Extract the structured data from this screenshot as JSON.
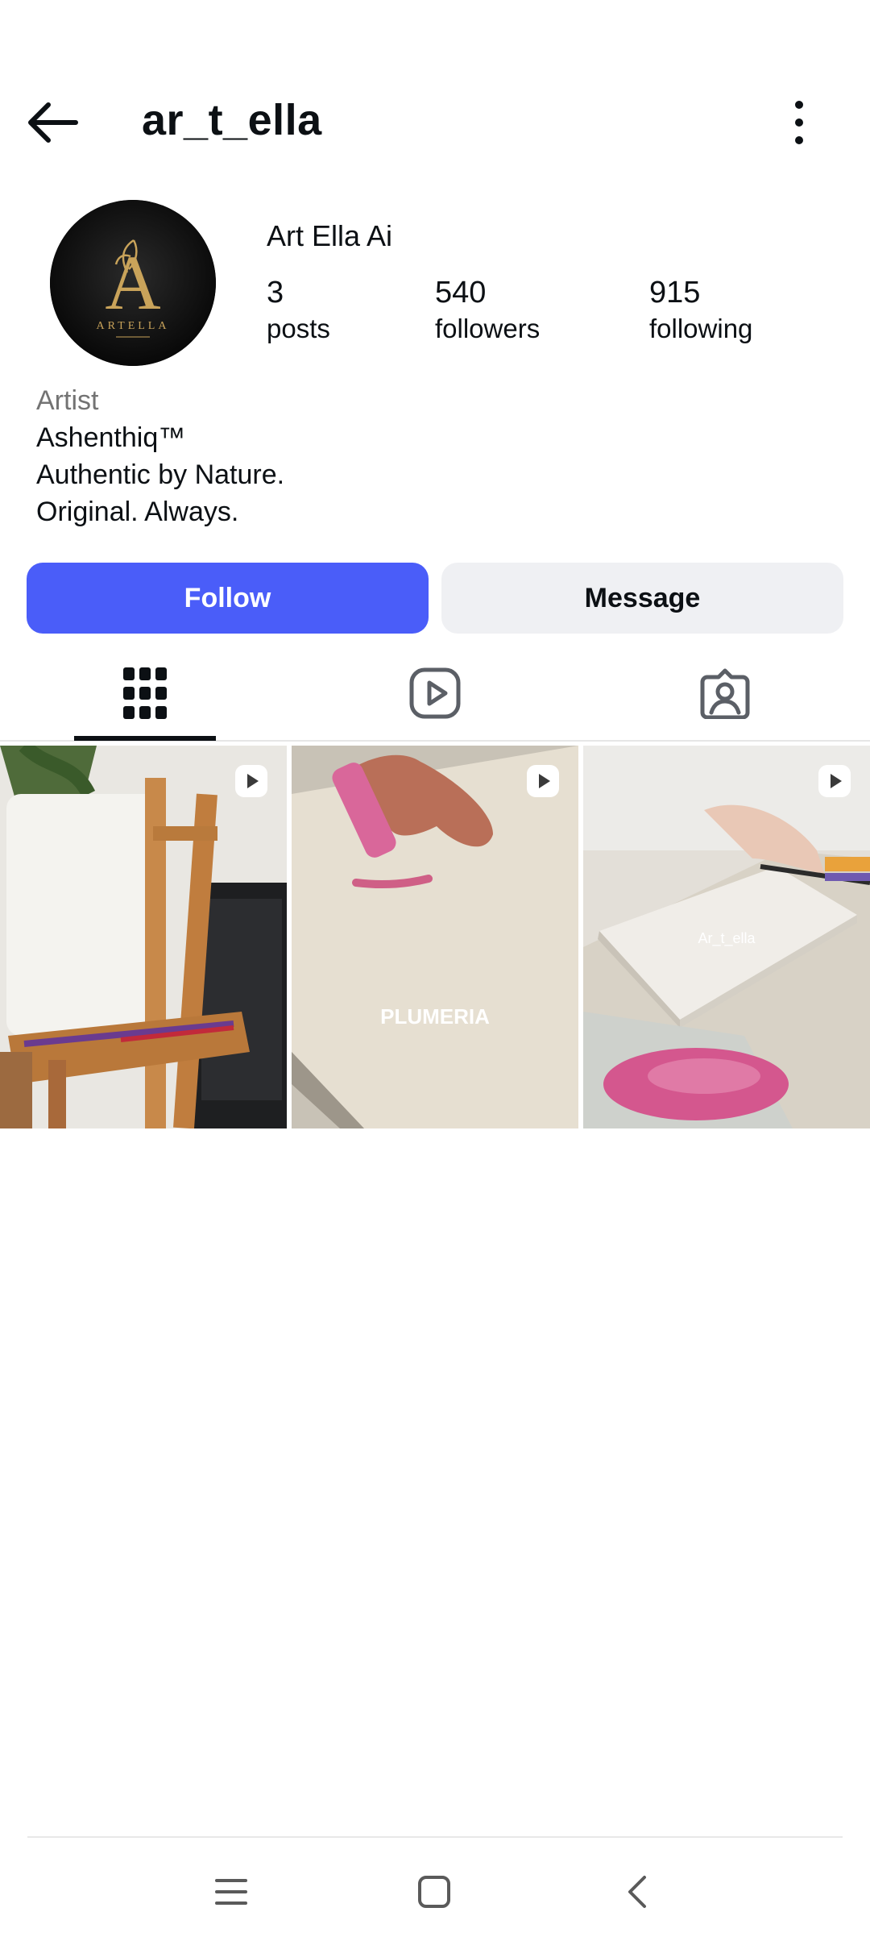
{
  "header": {
    "username": "ar_t_ella",
    "back_icon": "arrow-left-icon",
    "more_icon": "more-vertical-icon"
  },
  "profile": {
    "avatar_text": "ARTELLA",
    "avatar_letter": "A",
    "display_name": "Art Ella Ai",
    "stats": {
      "posts": {
        "value": "3",
        "label": "posts"
      },
      "followers": {
        "value": "540",
        "label": "followers"
      },
      "following": {
        "value": "915",
        "label": "following"
      }
    },
    "bio": {
      "category": "Artist",
      "lines": [
        "Ashenthiq™",
        "Authentic by Nature.",
        "Original. Always."
      ]
    }
  },
  "actions": {
    "follow": "Follow",
    "message": "Message"
  },
  "tabs": [
    {
      "icon": "grid-icon",
      "active": true
    },
    {
      "icon": "reels-icon",
      "active": false
    },
    {
      "icon": "tagged-icon",
      "active": false
    }
  ],
  "posts": [
    {
      "type": "reel",
      "caption": ""
    },
    {
      "type": "reel",
      "caption": "PLUMERIA"
    },
    {
      "type": "reel",
      "caption": "Ar_t_ella"
    }
  ],
  "system_nav": {
    "recents_icon": "menu-lines-icon",
    "home_icon": "home-square-icon",
    "back_icon": "chevron-left-icon"
  },
  "colors": {
    "accent": "#4a5df9",
    "secondary_button": "#eff0f3",
    "text": "#0c1014",
    "muted": "#737373",
    "gold": "#c9a35a"
  }
}
